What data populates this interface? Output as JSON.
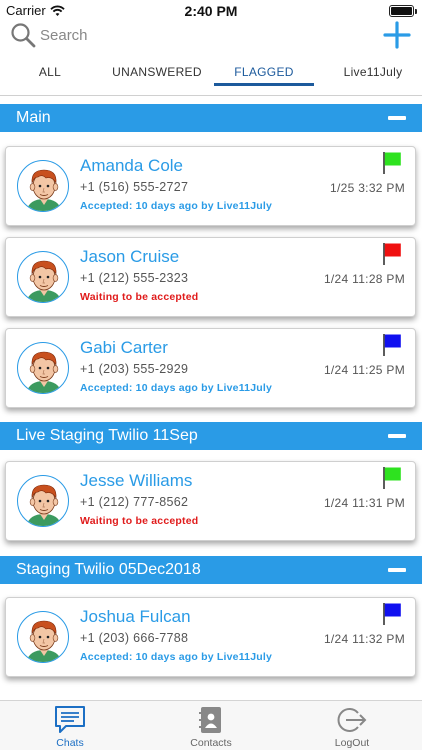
{
  "status_bar": {
    "carrier": "Carrier",
    "time": "2:40 PM"
  },
  "search": {
    "placeholder": "Search",
    "value": ""
  },
  "tabs": [
    {
      "label": "ALL",
      "active": false
    },
    {
      "label": "UNANSWERED",
      "active": false
    },
    {
      "label": "FLAGGED",
      "active": true
    },
    {
      "label": "Live11July",
      "active": false
    }
  ],
  "sections": [
    {
      "title": "Main",
      "chats": [
        {
          "name": "Amanda Cole",
          "phone": "+1 (516) 555-2727",
          "time": "1/25 3:32 PM",
          "status": "Accepted: 10 days ago by Live11July",
          "status_type": "accepted",
          "flag_color": "#2ee21f"
        },
        {
          "name": "Jason Cruise",
          "phone": "+1 (212) 555-2323",
          "time": "1/24 11:28 PM",
          "status": "Waiting to be accepted",
          "status_type": "waiting",
          "flag_color": "#f01010"
        },
        {
          "name": "Gabi Carter",
          "phone": "+1 (203) 555-2929",
          "time": "1/24 11:25 PM",
          "status": "Accepted: 10 days ago by Live11July",
          "status_type": "accepted",
          "flag_color": "#1010f0"
        }
      ]
    },
    {
      "title": "Live Staging Twilio 11Sep",
      "chats": [
        {
          "name": "Jesse Williams",
          "phone": "+1 (212) 777-8562",
          "time": "1/24 11:31 PM",
          "status": "Waiting to be accepted",
          "status_type": "waiting",
          "flag_color": "#2ee21f"
        }
      ]
    },
    {
      "title": "Staging Twilio 05Dec2018",
      "chats": [
        {
          "name": "Joshua Fulcan",
          "phone": "+1 (203) 666-7788",
          "time": "1/24 11:32 PM",
          "status": "Accepted: 10 days ago by Live11July",
          "status_type": "accepted",
          "flag_color": "#1010f0"
        }
      ]
    }
  ],
  "tab_bar": [
    {
      "label": "Chats",
      "icon": "chat-bubble-icon",
      "active": true
    },
    {
      "label": "Contacts",
      "icon": "contacts-book-icon",
      "active": false
    },
    {
      "label": "LogOut",
      "icon": "logout-icon",
      "active": false
    }
  ],
  "colors": {
    "accent": "#2a9be6",
    "tab_active": "#1c5a9c",
    "waiting": "#e01b1b"
  }
}
